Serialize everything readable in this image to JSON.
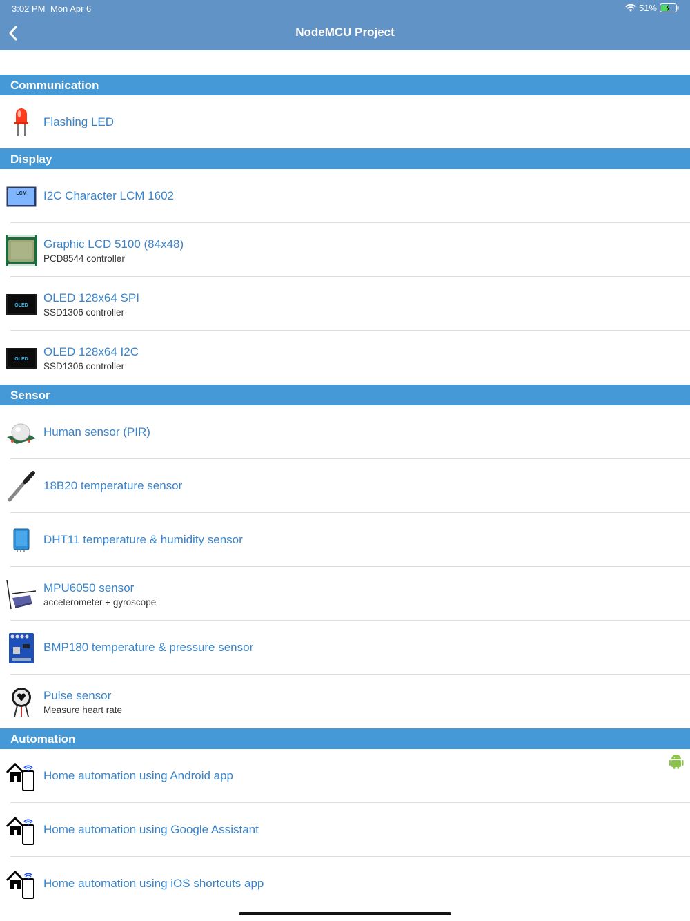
{
  "status_bar": {
    "time": "3:02 PM",
    "date": "Mon Apr 6",
    "battery": "51%"
  },
  "nav": {
    "title": "NodeMCU Project",
    "back_icon": "chevron-left-icon"
  },
  "colors": {
    "nav": "#6293c6",
    "section": "#4499d6",
    "link": "#3a84c9"
  },
  "sections": [
    {
      "title": "Communication",
      "items": [
        {
          "title": "Flashing LED",
          "subtitle": "",
          "icon": "led-icon"
        }
      ]
    },
    {
      "title": "Display",
      "items": [
        {
          "title": "I2C Character LCM 1602",
          "subtitle": "",
          "icon": "lcm-icon",
          "icon_text": "LCM"
        },
        {
          "title": "Graphic LCD 5100 (84x48)",
          "subtitle": "PCD8544 controller",
          "icon": "graphic-lcd-icon"
        },
        {
          "title": "OLED 128x64 SPI",
          "subtitle": "SSD1306 controller",
          "icon": "oled-icon",
          "icon_text": "OLED"
        },
        {
          "title": "OLED 128x64 I2C",
          "subtitle": "SSD1306 controller",
          "icon": "oled-icon",
          "icon_text": "OLED"
        }
      ]
    },
    {
      "title": "Sensor",
      "items": [
        {
          "title": "Human sensor (PIR)",
          "subtitle": "",
          "icon": "pir-sensor-icon"
        },
        {
          "title": "18B20 temperature sensor",
          "subtitle": "",
          "icon": "temperature-probe-icon"
        },
        {
          "title": "DHT11 temperature & humidity sensor",
          "subtitle": "",
          "icon": "dht11-icon"
        },
        {
          "title": "MPU6050 sensor",
          "subtitle": "accelerometer + gyroscope",
          "icon": "mpu6050-icon"
        },
        {
          "title": "BMP180 temperature & pressure sensor",
          "subtitle": "",
          "icon": "bmp180-icon"
        },
        {
          "title": "Pulse sensor",
          "subtitle": "Measure heart rate",
          "icon": "pulse-sensor-icon"
        }
      ]
    },
    {
      "title": "Automation",
      "items": [
        {
          "title": "Home automation using Android app",
          "subtitle": "",
          "icon": "home-automation-icon",
          "badge": "android-icon"
        },
        {
          "title": "Home automation using Google Assistant",
          "subtitle": "",
          "icon": "home-automation-icon"
        },
        {
          "title": "Home automation using iOS shortcuts app",
          "subtitle": "",
          "icon": "home-automation-icon"
        }
      ]
    }
  ]
}
